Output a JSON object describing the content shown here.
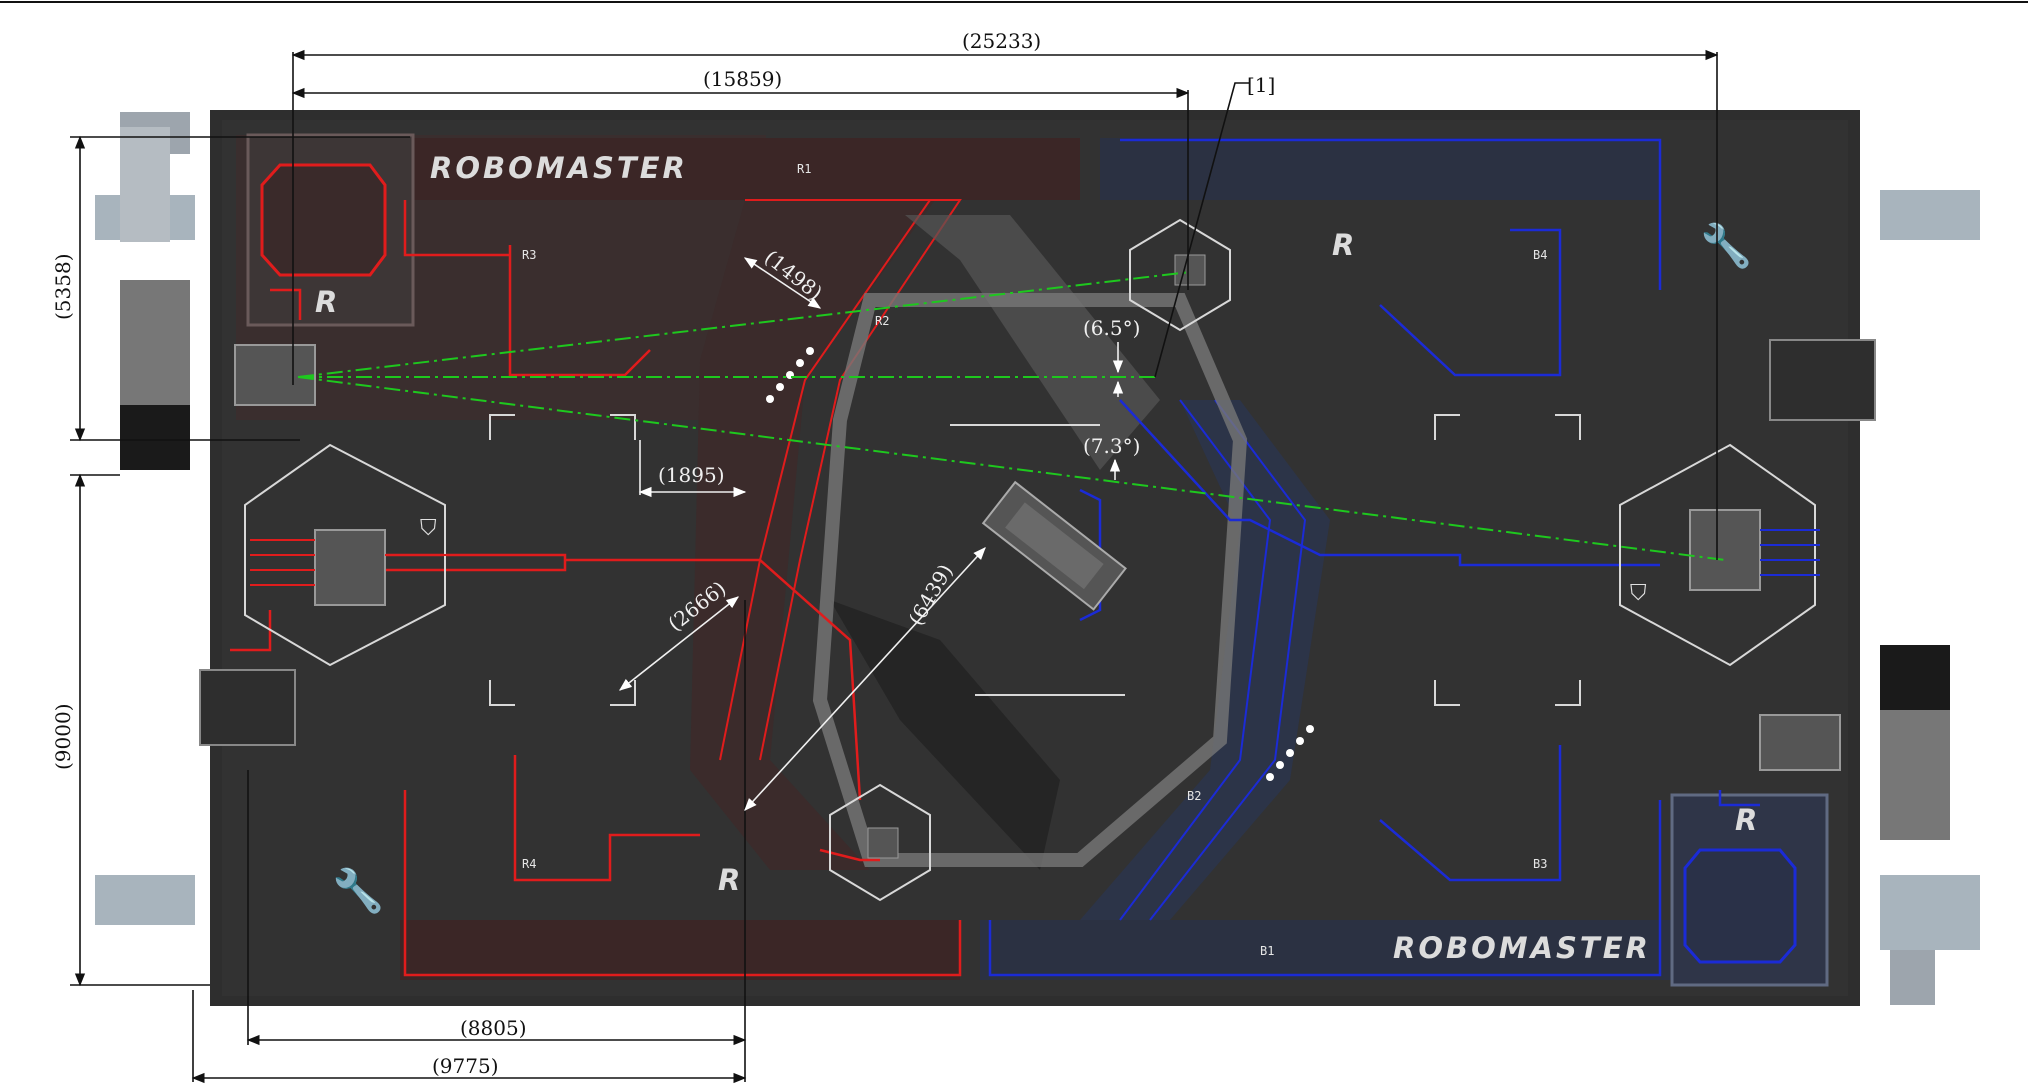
{
  "dimensions": {
    "overall_length": "(25233)",
    "length_to_marker": "(15859)",
    "callout": "[1]",
    "left_upper_height": "(5358)",
    "left_lower_height": "(9000)",
    "width_1498": "(1498)",
    "gap_1895": "(1895)",
    "width_2666": "(2666)",
    "diag_6439": "(6439)",
    "angle_upper": "(6.5°)",
    "angle_lower": "(7.3°)",
    "bottom_8805": "(8805)",
    "bottom_9775": "(9775)"
  },
  "field": {
    "logo_red": "ROBOMASTER",
    "logo_blue": "ROBOMASTER",
    "zones": {
      "r1": "R1",
      "r2": "R2",
      "r3": "R3",
      "r4": "R4",
      "b1": "B1",
      "b2": "B2",
      "b3": "B3",
      "b4": "B4"
    },
    "emblem": "R"
  },
  "colors": {
    "background": "#ffffff",
    "field_dark": "#2e2e2e",
    "red_team": "#e01c1c",
    "blue_team": "#1b2bd6",
    "sight_line": "#1ec81e",
    "dimension_line": "#111111"
  }
}
